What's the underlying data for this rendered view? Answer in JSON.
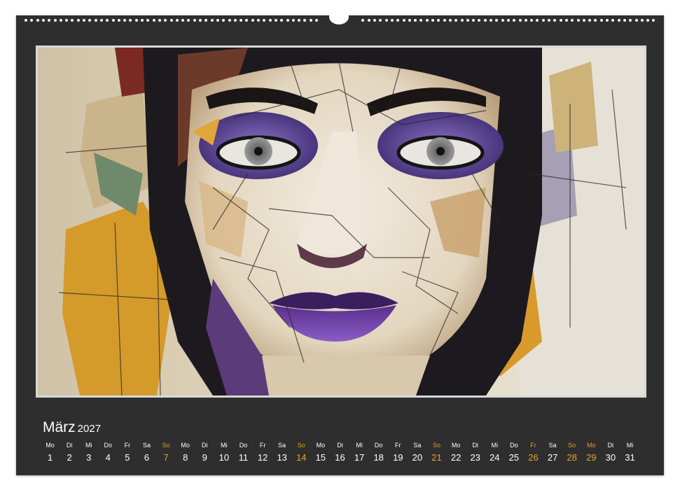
{
  "calendar": {
    "month": "März",
    "year": "2027",
    "artwork": "abstract-portrait",
    "colors": {
      "background": "#2e2e2e",
      "text": "#ffffff",
      "highlight": "#e5a322"
    },
    "days": [
      {
        "dn": "Mo",
        "num": "1",
        "hl": false
      },
      {
        "dn": "Di",
        "num": "2",
        "hl": false
      },
      {
        "dn": "Mi",
        "num": "3",
        "hl": false
      },
      {
        "dn": "Do",
        "num": "4",
        "hl": false
      },
      {
        "dn": "Fr",
        "num": "5",
        "hl": false
      },
      {
        "dn": "Sa",
        "num": "6",
        "hl": false
      },
      {
        "dn": "So",
        "num": "7",
        "hl": true
      },
      {
        "dn": "Mo",
        "num": "8",
        "hl": false
      },
      {
        "dn": "Di",
        "num": "9",
        "hl": false
      },
      {
        "dn": "Mi",
        "num": "10",
        "hl": false
      },
      {
        "dn": "Do",
        "num": "11",
        "hl": false
      },
      {
        "dn": "Fr",
        "num": "12",
        "hl": false
      },
      {
        "dn": "Sa",
        "num": "13",
        "hl": false
      },
      {
        "dn": "So",
        "num": "14",
        "hl": true
      },
      {
        "dn": "Mo",
        "num": "15",
        "hl": false
      },
      {
        "dn": "Di",
        "num": "16",
        "hl": false
      },
      {
        "dn": "Mi",
        "num": "17",
        "hl": false
      },
      {
        "dn": "Do",
        "num": "18",
        "hl": false
      },
      {
        "dn": "Fr",
        "num": "19",
        "hl": false
      },
      {
        "dn": "Sa",
        "num": "20",
        "hl": false
      },
      {
        "dn": "So",
        "num": "21",
        "hl": true
      },
      {
        "dn": "Mo",
        "num": "22",
        "hl": false
      },
      {
        "dn": "Di",
        "num": "23",
        "hl": false
      },
      {
        "dn": "Mi",
        "num": "24",
        "hl": false
      },
      {
        "dn": "Do",
        "num": "25",
        "hl": false
      },
      {
        "dn": "Fr",
        "num": "26",
        "hl": true
      },
      {
        "dn": "Sa",
        "num": "27",
        "hl": false
      },
      {
        "dn": "So",
        "num": "28",
        "hl": true
      },
      {
        "dn": "Mo",
        "num": "29",
        "hl": true
      },
      {
        "dn": "Di",
        "num": "30",
        "hl": false
      },
      {
        "dn": "Mi",
        "num": "31",
        "hl": false
      }
    ]
  }
}
